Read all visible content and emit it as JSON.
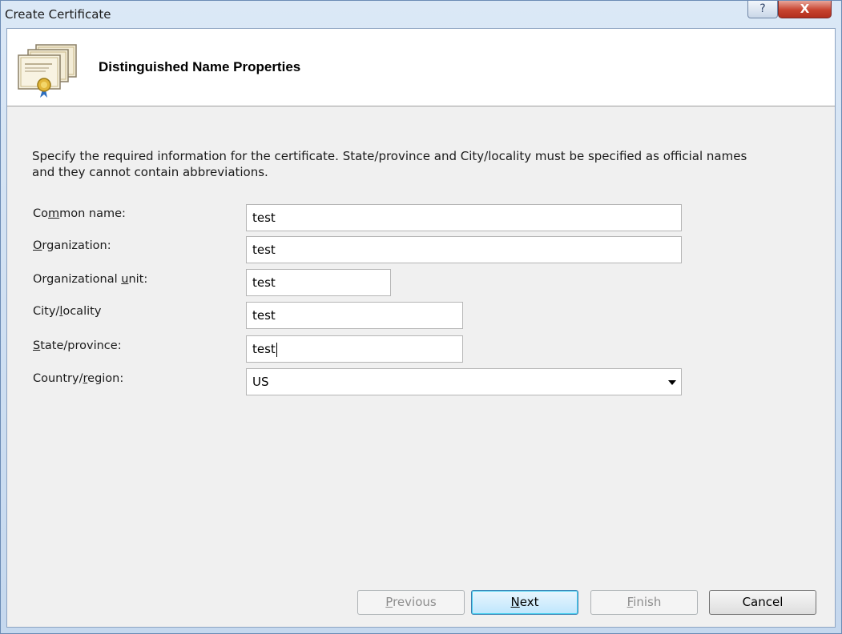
{
  "window": {
    "title": "Create Certificate",
    "help_label": "?",
    "close_label": "X"
  },
  "header": {
    "title": "Distinguished Name Properties"
  },
  "description": "Specify the required information for the certificate. State/province and City/locality must be specified as official names and they cannot contain abbreviations.",
  "form": {
    "common_name": {
      "label_pre": "Co",
      "label_key": "m",
      "label_post": "mon name:",
      "value": "test"
    },
    "organization": {
      "label_pre": "",
      "label_key": "O",
      "label_post": "rganization:",
      "value": "test"
    },
    "organizational_unit": {
      "label_pre": "Organizational ",
      "label_key": "u",
      "label_post": "nit:",
      "value": "test"
    },
    "city": {
      "label_pre": "City/",
      "label_key": "l",
      "label_post": "ocality",
      "value": "test"
    },
    "state": {
      "label_pre": "",
      "label_key": "S",
      "label_post": "tate/province:",
      "value": "test"
    },
    "country": {
      "label_pre": "Country/",
      "label_key": "r",
      "label_post": "egion:",
      "value": "US"
    }
  },
  "buttons": {
    "previous": {
      "key": "P",
      "rest": "revious"
    },
    "next": {
      "key": "N",
      "rest": "ext"
    },
    "finish": {
      "key": "F",
      "rest": "inish"
    },
    "cancel": "Cancel"
  }
}
